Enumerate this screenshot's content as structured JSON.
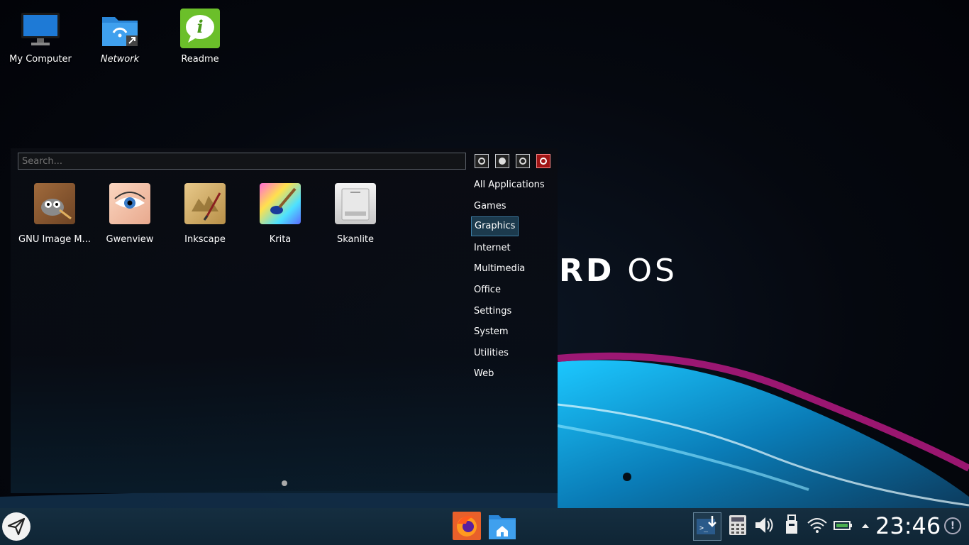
{
  "brand": {
    "bold": "RD",
    "light": "OS"
  },
  "desktop_icons": [
    {
      "label": "My Computer",
      "icon": "monitor-icon"
    },
    {
      "label": "Network",
      "icon": "network-folder-icon"
    },
    {
      "label": "Readme",
      "icon": "info-bubble-icon"
    }
  ],
  "launcher": {
    "search_placeholder": "Search...",
    "toolbar": [
      {
        "icon": "settings-icon"
      },
      {
        "icon": "lock-icon"
      },
      {
        "icon": "logout-icon"
      },
      {
        "icon": "power-icon",
        "color": "#a01414"
      }
    ],
    "apps": [
      {
        "label": "GNU Image M...",
        "icon": "gimp-icon"
      },
      {
        "label": "Gwenview",
        "icon": "gwenview-icon"
      },
      {
        "label": "Inkscape",
        "icon": "inkscape-icon"
      },
      {
        "label": "Krita",
        "icon": "krita-icon"
      },
      {
        "label": "Skanlite",
        "icon": "scanner-icon"
      }
    ],
    "categories": [
      "All Applications",
      "Games",
      "Graphics",
      "Internet",
      "Multimedia",
      "Office",
      "Settings",
      "System",
      "Utilities",
      "Web"
    ],
    "selected_category": "Graphics"
  },
  "taskbar": {
    "tasks": [
      {
        "icon": "firefox-icon"
      },
      {
        "icon": "home-folder-icon"
      }
    ],
    "tray": [
      "terminal-download-icon",
      "calculator-icon",
      "volume-icon",
      "usb-device-icon",
      "wifi-icon",
      "battery-icon",
      "expand-arrow-icon"
    ],
    "clock": "23:46",
    "accent": "#3e7fa6"
  }
}
